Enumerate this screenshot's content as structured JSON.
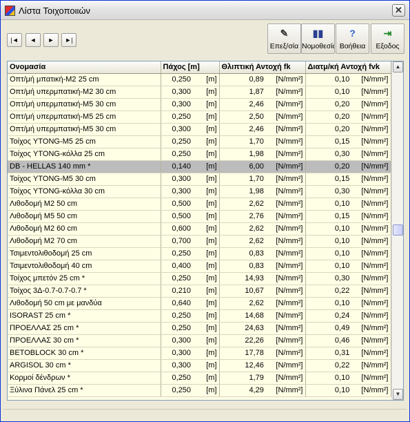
{
  "window": {
    "title": "Λίστα Τοιχοποιιών",
    "close_label": "✕"
  },
  "nav": [
    {
      "name": "first-record-button",
      "glyph": "|◄"
    },
    {
      "name": "prev-record-button",
      "glyph": "◄"
    },
    {
      "name": "next-record-button",
      "glyph": "►"
    },
    {
      "name": "last-record-button",
      "glyph": "►|"
    }
  ],
  "toolbar": [
    {
      "name": "edit-button",
      "label": "Επεξ/σία",
      "icon": "edit-icon",
      "color": "#3a3a3a",
      "glyph": "✎"
    },
    {
      "name": "legislation-button",
      "label": "Νομοθεσία",
      "icon": "bar-chart-icon",
      "color": "#2a3f8f",
      "glyph": "▮▮"
    },
    {
      "name": "help-button",
      "label": "Βοήθεια",
      "icon": "question-icon",
      "color": "#2d62d0",
      "glyph": "?"
    },
    {
      "name": "exit-button",
      "label": "Εξοδος",
      "icon": "exit-door-icon",
      "color": "#1f8a2a",
      "glyph": "⇥"
    }
  ],
  "table": {
    "headers": [
      "Ονομασία",
      "Πάχος [m]",
      "Θλιπτική Αντοχή fk",
      "Διατμ/κή Αντοχή fvk"
    ],
    "selected_index": 7,
    "rows": [
      [
        "Οπτ/μή μπατική-Μ2 25 cm",
        "0,250",
        "[m]",
        "0,89",
        "[N/mm²]",
        "0,10",
        "[N/mm²]"
      ],
      [
        "Οπτ/μή υπερμπατική-Μ2 30 cm",
        "0,300",
        "[m]",
        "1,87",
        "[N/mm²]",
        "0,10",
        "[N/mm²]"
      ],
      [
        "Οπτ/μή υπερμπατική-Μ5 30 cm",
        "0,300",
        "[m]",
        "2,46",
        "[N/mm²]",
        "0,20",
        "[N/mm²]"
      ],
      [
        "Οπτ/μή υπερμπατική-Μ5 25 cm",
        "0,250",
        "[m]",
        "2,50",
        "[N/mm²]",
        "0,20",
        "[N/mm²]"
      ],
      [
        "Οπτ/μή υπερμπατική-Μ5 30 cm",
        "0,300",
        "[m]",
        "2,46",
        "[N/mm²]",
        "0,20",
        "[N/mm²]"
      ],
      [
        "Τοίχος YTONG-M5 25 cm",
        "0,250",
        "[m]",
        "1,70",
        "[N/mm²]",
        "0,15",
        "[N/mm²]"
      ],
      [
        "Τοίχος YTONG-κόλλα 25 cm",
        "0,250",
        "[m]",
        "1,98",
        "[N/mm²]",
        "0,30",
        "[N/mm²]"
      ],
      [
        "DB - HELLAS 140 mm *",
        "0,140",
        "[m]",
        "6,00",
        "[N/mm²]",
        "0,20",
        "[N/mm²]"
      ],
      [
        "Τοίχος YTONG-M5 30 cm",
        "0,300",
        "[m]",
        "1,70",
        "[N/mm²]",
        "0,15",
        "[N/mm²]"
      ],
      [
        "Τοίχος YTONG-κόλλα 30 cm",
        "0,300",
        "[m]",
        "1,98",
        "[N/mm²]",
        "0,30",
        "[N/mm²]"
      ],
      [
        "Λιθοδομή M2 50 cm",
        "0,500",
        "[m]",
        "2,62",
        "[N/mm²]",
        "0,10",
        "[N/mm²]"
      ],
      [
        "Λιθοδομή M5 50 cm",
        "0,500",
        "[m]",
        "2,76",
        "[N/mm²]",
        "0,15",
        "[N/mm²]"
      ],
      [
        "Λιθοδομή M2 60 cm",
        "0,600",
        "[m]",
        "2,62",
        "[N/mm²]",
        "0,10",
        "[N/mm²]"
      ],
      [
        "Λιθοδομή M2 70 cm",
        "0,700",
        "[m]",
        "2,62",
        "[N/mm²]",
        "0,10",
        "[N/mm²]"
      ],
      [
        "Τσιμεντολιθοδομή 25 cm",
        "0,250",
        "[m]",
        "0,83",
        "[N/mm²]",
        "0,10",
        "[N/mm²]"
      ],
      [
        "Τσιμεντολιθοδομή 40 cm",
        "0,400",
        "[m]",
        "0,83",
        "[N/mm²]",
        "0,10",
        "[N/mm²]"
      ],
      [
        "Τοίχος μπετόν 25 cm *",
        "0,250",
        "[m]",
        "14,93",
        "[N/mm²]",
        "0,30",
        "[N/mm²]"
      ],
      [
        "Τοίχος 3Δ-0.7-0.7-0.7 *",
        "0,210",
        "[m]",
        "10,67",
        "[N/mm²]",
        "0,22",
        "[N/mm²]"
      ],
      [
        "Λιθοδομή 50 cm με μανδύα",
        "0,640",
        "[m]",
        "2,62",
        "[N/mm²]",
        "0,10",
        "[N/mm²]"
      ],
      [
        "ISORAST 25 cm *",
        "0,250",
        "[m]",
        "14,68",
        "[N/mm²]",
        "0,24",
        "[N/mm²]"
      ],
      [
        "ΠΡΟΕΛΛΑΣ 25 cm *",
        "0,250",
        "[m]",
        "24,63",
        "[N/mm²]",
        "0,49",
        "[N/mm²]"
      ],
      [
        "ΠΡΟΕΛΛΑΣ 30 cm *",
        "0,300",
        "[m]",
        "22,26",
        "[N/mm²]",
        "0,46",
        "[N/mm²]"
      ],
      [
        "BETOBLOCK 30 cm  *",
        "0,300",
        "[m]",
        "17,78",
        "[N/mm²]",
        "0,31",
        "[N/mm²]"
      ],
      [
        "ARGISOL 30 cm *",
        "0,300",
        "[m]",
        "12,46",
        "[N/mm²]",
        "0,22",
        "[N/mm²]"
      ],
      [
        "Κορμοί δένδρων *",
        "0,250",
        "[m]",
        "1,79",
        "[N/mm²]",
        "0,10",
        "[N/mm²]"
      ],
      [
        "Ξύλινα Πάνελ 25 cm *",
        "0,250",
        "[m]",
        "4,29",
        "[N/mm²]",
        "0,10",
        "[N/mm²]"
      ]
    ]
  },
  "scrollbar": {
    "up_glyph": "▲",
    "down_glyph": "▼"
  }
}
